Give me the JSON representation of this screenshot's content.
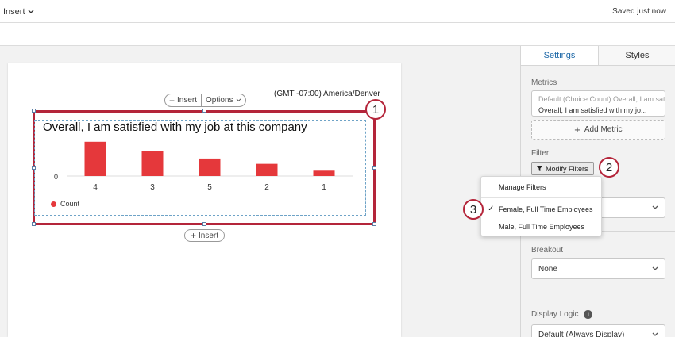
{
  "topbar": {
    "insert_label": "Insert",
    "saved_text": "Saved just now"
  },
  "canvas": {
    "timezone": "(GMT -07:00) America/Denver",
    "widget_toolbar": {
      "insert_label": "Insert",
      "options_label": "Options"
    },
    "bottom_insert_label": "Insert"
  },
  "callouts": {
    "one": "1",
    "two": "2",
    "three": "3"
  },
  "colors": {
    "bar": "#e5383b",
    "outline": "#b4253a",
    "tab_active": "#1f69a8"
  },
  "chart_data": {
    "type": "bar",
    "title": "Overall, I am satisfied with my job at this company",
    "categories": [
      "4",
      "3",
      "5",
      "2",
      "1"
    ],
    "values": [
      45,
      33,
      23,
      16,
      7
    ],
    "ylim": [
      0,
      50
    ],
    "y_tick_labels": [
      "0"
    ],
    "series": [
      {
        "name": "Count",
        "values": [
          45,
          33,
          23,
          16,
          7
        ]
      }
    ],
    "legend": "bottom-left",
    "grid": false
  },
  "panel": {
    "tabs": [
      {
        "label": "Settings",
        "active": true
      },
      {
        "label": "Styles",
        "active": false
      }
    ],
    "metrics_label": "Metrics",
    "metric_placeholder": "Default (Choice Count) Overall, I am satis",
    "metric_value": "Overall, I am satisfied with my jo...",
    "add_metric_label": "Add Metric",
    "filter_label": "Filter",
    "modify_filters_label": "Modify Filters",
    "breakout_label": "Breakout",
    "breakout_value": "None",
    "display_logic_label": "Display Logic",
    "display_logic_value": "Default (Always Display)"
  },
  "dropdown": {
    "items": [
      {
        "label": "Manage Filters",
        "checked": false
      },
      {
        "label": "Female, Full Time Employees",
        "checked": true
      },
      {
        "label": "Male, Full Time Employees",
        "checked": false
      }
    ]
  },
  "icons": [
    "chevron-down-icon",
    "plus-icon",
    "filter-icon",
    "check-icon",
    "info-icon"
  ]
}
